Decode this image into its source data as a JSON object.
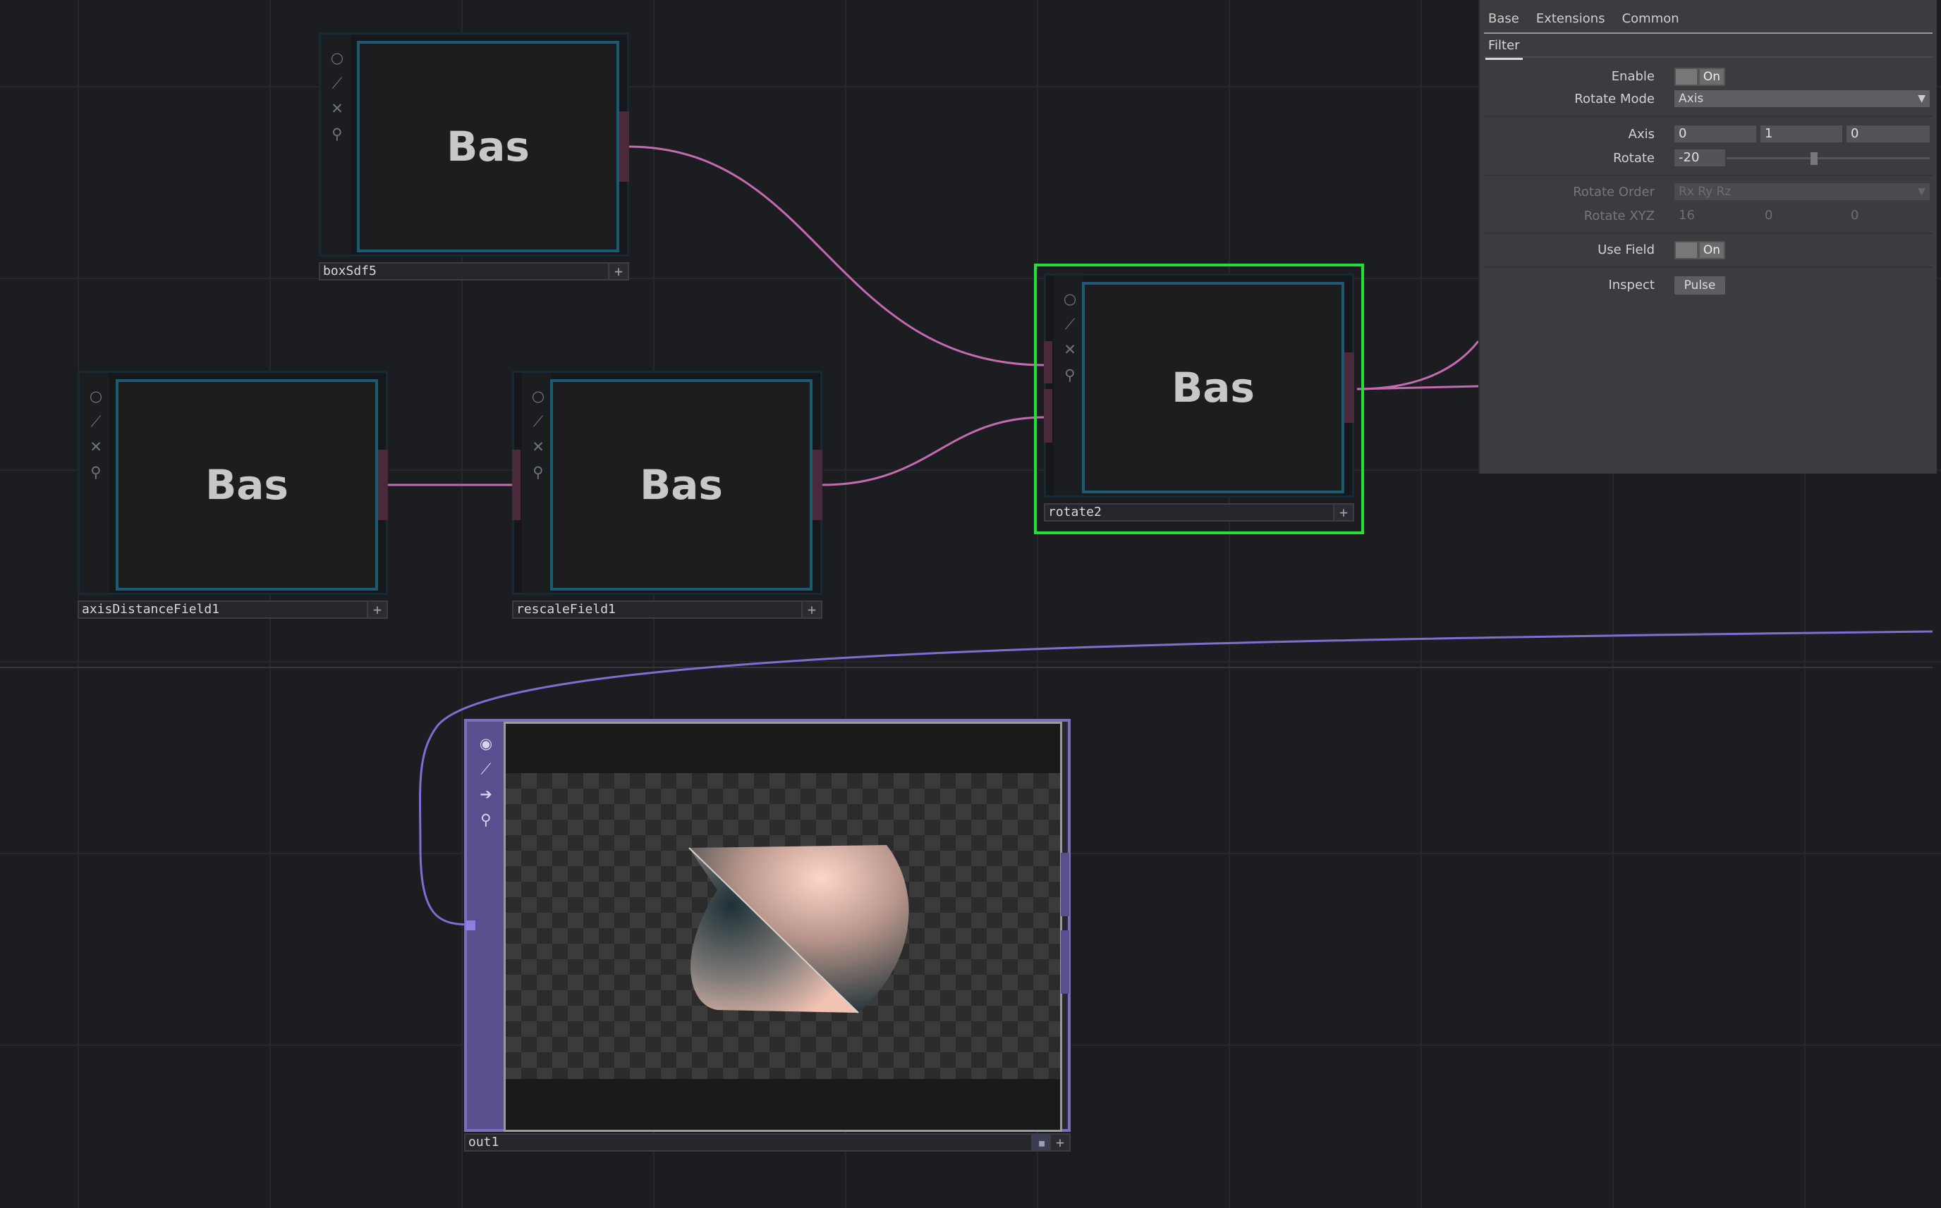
{
  "nodes": [
    {
      "name": "boxSdf5",
      "preview": "Bas"
    },
    {
      "name": "axisDistanceField1",
      "preview": "Bas"
    },
    {
      "name": "rescaleField1",
      "preview": "Bas"
    },
    {
      "name": "rotate2",
      "preview": "Bas"
    }
  ],
  "output_node": {
    "name": "out1"
  },
  "node_flags": [
    "circle-icon",
    "wand-icon",
    "close-icon",
    "link-icon"
  ],
  "output_flags": [
    "circle-icon",
    "wand-icon",
    "arrow-right-icon",
    "link-icon"
  ],
  "colors": {
    "wire": "#c46ab0",
    "output_wire": "#7c6fd0",
    "selected": "#22e03a",
    "viewer_border": "#1b5a72"
  },
  "panel": {
    "tabs": [
      "Base",
      "Extensions",
      "Common"
    ],
    "active_page": "Filter",
    "params": {
      "enable": {
        "label": "Enable",
        "value": "On"
      },
      "rotate_mode": {
        "label": "Rotate Mode",
        "value": "Axis"
      },
      "axis": {
        "label": "Axis",
        "values": [
          "0",
          "1",
          "0"
        ]
      },
      "rotate": {
        "label": "Rotate",
        "value": "-20",
        "slider_fraction": 0.43
      },
      "rotate_order": {
        "label": "Rotate Order",
        "value": "Rx Ry Rz"
      },
      "rotate_xyz": {
        "label": "Rotate XYZ",
        "values": [
          "16",
          "0",
          "0"
        ]
      },
      "use_field": {
        "label": "Use Field",
        "value": "On"
      },
      "inspect": {
        "label": "Inspect",
        "value": "Pulse"
      }
    }
  }
}
